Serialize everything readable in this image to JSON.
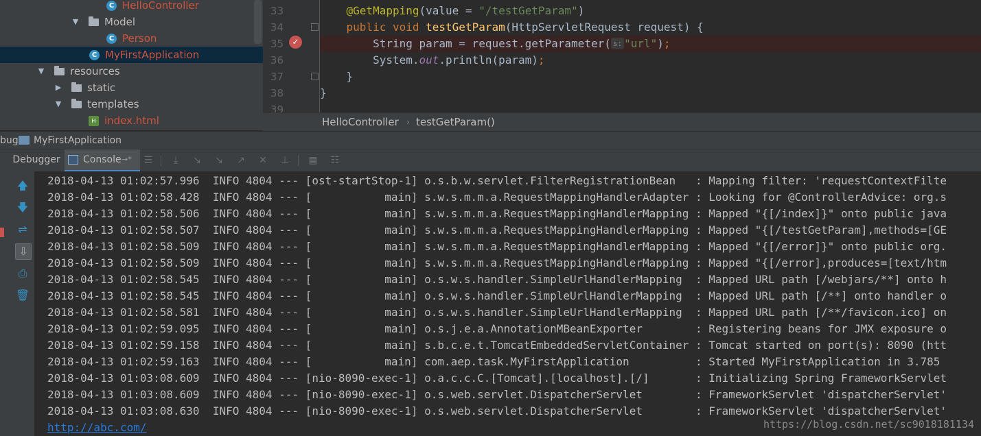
{
  "project_tree": [
    {
      "label": "HelloController",
      "kind": "class",
      "color": "#d0553f",
      "indent": 178,
      "expander": ""
    },
    {
      "label": "Model",
      "kind": "folder",
      "color": "#bbbbbb",
      "indent": 152,
      "expander": "▼"
    },
    {
      "label": "Person",
      "kind": "class",
      "color": "#d0553f",
      "indent": 178,
      "expander": ""
    },
    {
      "label": "MyFirstApplication",
      "kind": "class",
      "color": "#d0553f",
      "indent": 153,
      "expander": "",
      "selected": true
    },
    {
      "label": "resources",
      "kind": "folder",
      "color": "#bbbbbb",
      "indent": 102,
      "expander": "▼"
    },
    {
      "label": "static",
      "kind": "folder",
      "color": "#bbbbbb",
      "indent": 127,
      "expander": "▶"
    },
    {
      "label": "templates",
      "kind": "folder",
      "color": "#bbbbbb",
      "indent": 127,
      "expander": "▼"
    },
    {
      "label": "index.html",
      "kind": "html",
      "color": "#d0553f",
      "indent": 152,
      "expander": ""
    }
  ],
  "editor": {
    "line_numbers": [
      "33",
      "34",
      "35",
      "36",
      "37",
      "38",
      "39"
    ],
    "code": {
      "l33": {
        "ann": "@GetMapping",
        "p1": "(value = ",
        "str": "\"/testGetParam\"",
        "p2": ")"
      },
      "l34": {
        "kw1": "public ",
        "kw2": "void ",
        "fn": "testGetParam",
        "rest": "(HttpServletRequest request) {"
      },
      "l35": {
        "p1": "String param = request.getParameter(",
        "hint": "s:",
        "str": "\"url\"",
        "p2": ")",
        "semi": ";"
      },
      "l36": {
        "p1": "System.",
        "st": "out",
        "p2": ".println(param)",
        "semi": ";"
      },
      "l37": {
        "p1": "}"
      },
      "l38": {
        "p1": "}"
      }
    },
    "breakpoint_icon": "breakpoint-check-icon"
  },
  "breadcrumb": {
    "class": "HelloController",
    "method": "testGetParam()"
  },
  "debug": {
    "title_prefix": "bug",
    "run_config": "MyFirstApplication",
    "tab_debugger": "Debugger",
    "tab_console": "Console",
    "pin_glyph": "→*"
  },
  "console_lines": [
    "2018-04-13 01:02:57.996  INFO 4804 --- [ost-startStop-1] o.s.b.w.servlet.FilterRegistrationBean   : Mapping filter: 'requestContextFilte",
    "2018-04-13 01:02:58.428  INFO 4804 --- [           main] s.w.s.m.m.a.RequestMappingHandlerAdapter : Looking for @ControllerAdvice: org.s",
    "2018-04-13 01:02:58.506  INFO 4804 --- [           main] s.w.s.m.m.a.RequestMappingHandlerMapping : Mapped \"{[/index]}\" onto public java",
    "2018-04-13 01:02:58.507  INFO 4804 --- [           main] s.w.s.m.m.a.RequestMappingHandlerMapping : Mapped \"{[/testGetParam],methods=[GE",
    "2018-04-13 01:02:58.509  INFO 4804 --- [           main] s.w.s.m.m.a.RequestMappingHandlerMapping : Mapped \"{[/error]}\" onto public org.",
    "2018-04-13 01:02:58.509  INFO 4804 --- [           main] s.w.s.m.m.a.RequestMappingHandlerMapping : Mapped \"{[/error],produces=[text/htm",
    "2018-04-13 01:02:58.545  INFO 4804 --- [           main] o.s.w.s.handler.SimpleUrlHandlerMapping  : Mapped URL path [/webjars/**] onto h",
    "2018-04-13 01:02:58.545  INFO 4804 --- [           main] o.s.w.s.handler.SimpleUrlHandlerMapping  : Mapped URL path [/**] onto handler o",
    "2018-04-13 01:02:58.581  INFO 4804 --- [           main] o.s.w.s.handler.SimpleUrlHandlerMapping  : Mapped URL path [/**/favicon.ico] on",
    "2018-04-13 01:02:59.095  INFO 4804 --- [           main] o.s.j.e.a.AnnotationMBeanExporter        : Registering beans for JMX exposure o",
    "2018-04-13 01:02:59.158  INFO 4804 --- [           main] s.b.c.e.t.TomcatEmbeddedServletContainer : Tomcat started on port(s): 8090 (htt",
    "2018-04-13 01:02:59.163  INFO 4804 --- [           main] com.aep.task.MyFirstApplication          : Started MyFirstApplication in 3.785 ",
    "2018-04-13 01:03:08.609  INFO 4804 --- [nio-8090-exec-1] o.a.c.c.C.[Tomcat].[localhost].[/]       : Initializing Spring FrameworkServlet",
    "2018-04-13 01:03:08.609  INFO 4804 --- [nio-8090-exec-1] o.s.web.servlet.DispatcherServlet        : FrameworkServlet 'dispatcherServlet'",
    "2018-04-13 01:03:08.630  INFO 4804 --- [nio-8090-exec-1] o.s.web.servlet.DispatcherServlet        : FrameworkServlet 'dispatcherServlet'"
  ],
  "console_link": "http://abc.com/",
  "watermark": "https://blog.csdn.net/sc9018181134",
  "colors": {
    "accent": "#4a88c7",
    "breakpoint": "#c75450",
    "link": "#287bde"
  }
}
